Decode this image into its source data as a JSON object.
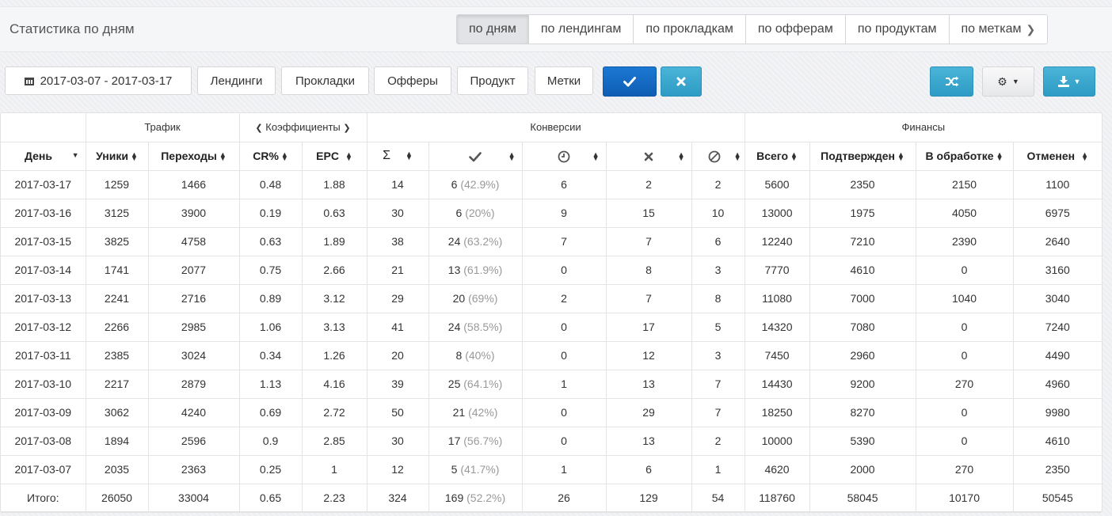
{
  "header": {
    "title": "Статистика по дням",
    "tabs": [
      {
        "label": "по дням"
      },
      {
        "label": "по лендингам"
      },
      {
        "label": "по прокладкам"
      },
      {
        "label": "по офферам"
      },
      {
        "label": "по продуктам"
      },
      {
        "label": "по меткам"
      }
    ]
  },
  "toolbar": {
    "date_range": "2017-03-07 - 2017-03-17",
    "filters": [
      "Лендинги",
      "Прокладки",
      "Офферы",
      "Продукт",
      "Метки"
    ],
    "icons": {
      "apply": "check-icon",
      "reset": "times-icon",
      "shuffle": "random-icon",
      "settings": "cog-icon",
      "download": "download-icon"
    },
    "colors": {
      "primary": "#1169c4",
      "info": "#39a7d0"
    }
  },
  "table": {
    "groups": {
      "traffic": "Трафик",
      "coefficients": "Коэффициенты",
      "conversions": "Конверсии",
      "finance": "Финансы"
    },
    "columns": {
      "day": "День",
      "uniques": "Уники",
      "clicks": "Переходы",
      "cr": "CR%",
      "epc": "EPC",
      "sum": "Σ",
      "approved_icon": "check-icon",
      "hold_icon": "clock-icon",
      "rejected_icon": "times-icon",
      "trash_icon": "ban-icon",
      "total": "Всего",
      "confirmed": "Подтвержден",
      "processing": "В обработке",
      "canceled": "Отменен"
    },
    "rows": [
      {
        "day": "2017-03-17",
        "uniques": "1259",
        "clicks": "1466",
        "cr": "0.48",
        "epc": "1.88",
        "sum": "14",
        "approved": "6",
        "approved_pct": "(42.9%)",
        "hold": "6",
        "rejected": "2",
        "trash": "2",
        "total": "5600",
        "confirmed": "2350",
        "processing": "2150",
        "canceled": "1100"
      },
      {
        "day": "2017-03-16",
        "uniques": "3125",
        "clicks": "3900",
        "cr": "0.19",
        "epc": "0.63",
        "sum": "30",
        "approved": "6",
        "approved_pct": "(20%)",
        "hold": "9",
        "rejected": "15",
        "trash": "10",
        "total": "13000",
        "confirmed": "1975",
        "processing": "4050",
        "canceled": "6975"
      },
      {
        "day": "2017-03-15",
        "uniques": "3825",
        "clicks": "4758",
        "cr": "0.63",
        "epc": "1.89",
        "sum": "38",
        "approved": "24",
        "approved_pct": "(63.2%)",
        "hold": "7",
        "rejected": "7",
        "trash": "6",
        "total": "12240",
        "confirmed": "7210",
        "processing": "2390",
        "canceled": "2640"
      },
      {
        "day": "2017-03-14",
        "uniques": "1741",
        "clicks": "2077",
        "cr": "0.75",
        "epc": "2.66",
        "sum": "21",
        "approved": "13",
        "approved_pct": "(61.9%)",
        "hold": "0",
        "rejected": "8",
        "trash": "3",
        "total": "7770",
        "confirmed": "4610",
        "processing": "0",
        "canceled": "3160"
      },
      {
        "day": "2017-03-13",
        "uniques": "2241",
        "clicks": "2716",
        "cr": "0.89",
        "epc": "3.12",
        "sum": "29",
        "approved": "20",
        "approved_pct": "(69%)",
        "hold": "2",
        "rejected": "7",
        "trash": "8",
        "total": "11080",
        "confirmed": "7000",
        "processing": "1040",
        "canceled": "3040"
      },
      {
        "day": "2017-03-12",
        "uniques": "2266",
        "clicks": "2985",
        "cr": "1.06",
        "epc": "3.13",
        "sum": "41",
        "approved": "24",
        "approved_pct": "(58.5%)",
        "hold": "0",
        "rejected": "17",
        "trash": "5",
        "total": "14320",
        "confirmed": "7080",
        "processing": "0",
        "canceled": "7240"
      },
      {
        "day": "2017-03-11",
        "uniques": "2385",
        "clicks": "3024",
        "cr": "0.34",
        "epc": "1.26",
        "sum": "20",
        "approved": "8",
        "approved_pct": "(40%)",
        "hold": "0",
        "rejected": "12",
        "trash": "3",
        "total": "7450",
        "confirmed": "2960",
        "processing": "0",
        "canceled": "4490"
      },
      {
        "day": "2017-03-10",
        "uniques": "2217",
        "clicks": "2879",
        "cr": "1.13",
        "epc": "4.16",
        "sum": "39",
        "approved": "25",
        "approved_pct": "(64.1%)",
        "hold": "1",
        "rejected": "13",
        "trash": "7",
        "total": "14430",
        "confirmed": "9200",
        "processing": "270",
        "canceled": "4960"
      },
      {
        "day": "2017-03-09",
        "uniques": "3062",
        "clicks": "4240",
        "cr": "0.69",
        "epc": "2.72",
        "sum": "50",
        "approved": "21",
        "approved_pct": "(42%)",
        "hold": "0",
        "rejected": "29",
        "trash": "7",
        "total": "18250",
        "confirmed": "8270",
        "processing": "0",
        "canceled": "9980"
      },
      {
        "day": "2017-03-08",
        "uniques": "1894",
        "clicks": "2596",
        "cr": "0.9",
        "epc": "2.85",
        "sum": "30",
        "approved": "17",
        "approved_pct": "(56.7%)",
        "hold": "0",
        "rejected": "13",
        "trash": "2",
        "total": "10000",
        "confirmed": "5390",
        "processing": "0",
        "canceled": "4610"
      },
      {
        "day": "2017-03-07",
        "uniques": "2035",
        "clicks": "2363",
        "cr": "0.25",
        "epc": "1",
        "sum": "12",
        "approved": "5",
        "approved_pct": "(41.7%)",
        "hold": "1",
        "rejected": "6",
        "trash": "1",
        "total": "4620",
        "confirmed": "2000",
        "processing": "270",
        "canceled": "2350"
      }
    ],
    "totals": {
      "day": "Итого:",
      "uniques": "26050",
      "clicks": "33004",
      "cr": "0.65",
      "epc": "2.23",
      "sum": "324",
      "approved": "169",
      "approved_pct": "(52.2%)",
      "hold": "26",
      "rejected": "129",
      "trash": "54",
      "total": "118760",
      "confirmed": "58045",
      "processing": "10170",
      "canceled": "50545"
    }
  }
}
